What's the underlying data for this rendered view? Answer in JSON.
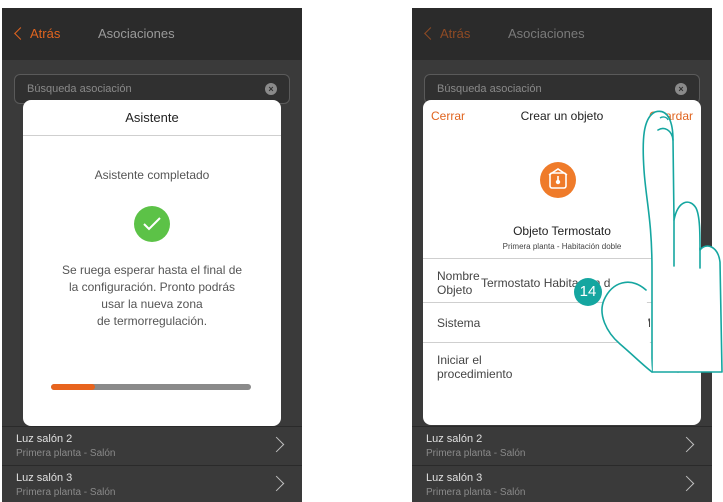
{
  "left": {
    "back_label": "Atrás",
    "title": "Asociaciones",
    "search_placeholder": "Búsqueda asociación",
    "dialog": {
      "title": "Asistente",
      "subtitle": "Asistente completado",
      "message_lines": [
        "Se ruega esperar hasta el final de",
        "la configuración. Pronto podrás",
        "usar la nueva zona",
        "de termorregulación."
      ],
      "progress": 0.22
    },
    "list": [
      {
        "name": "Luz salón 2",
        "location": "Primera planta - Salón"
      },
      {
        "name": "Luz salón 3",
        "location": "Primera planta - Salón"
      }
    ]
  },
  "right": {
    "back_label": "Atrás",
    "title": "Asociaciones",
    "search_placeholder": "Búsqueda asociación",
    "dialog": {
      "close_label": "Cerrar",
      "title": "Crear un objeto",
      "save_label": "Guardar",
      "object_title": "Objeto Termostato",
      "object_location": "Primera planta - Habitación doble",
      "fields": [
        {
          "label_lines": [
            "Nombre",
            "Objeto"
          ],
          "value": "Termostato Habitación d"
        },
        {
          "label_lines": [
            "Sistema"
          ],
          "value": "MyHOME"
        },
        {
          "label_lines": [
            "Iniciar el",
            "procedimiento"
          ],
          "value": ""
        }
      ]
    },
    "list": [
      {
        "name": "Luz salón 2",
        "location": "Primera planta - Salón"
      },
      {
        "name": "Luz salón 3",
        "location": "Primera planta - Salón"
      }
    ]
  },
  "step_badge": "14",
  "colors": {
    "accent": "#e0641f",
    "success": "#5cc247",
    "badge": "#15a6a0"
  }
}
